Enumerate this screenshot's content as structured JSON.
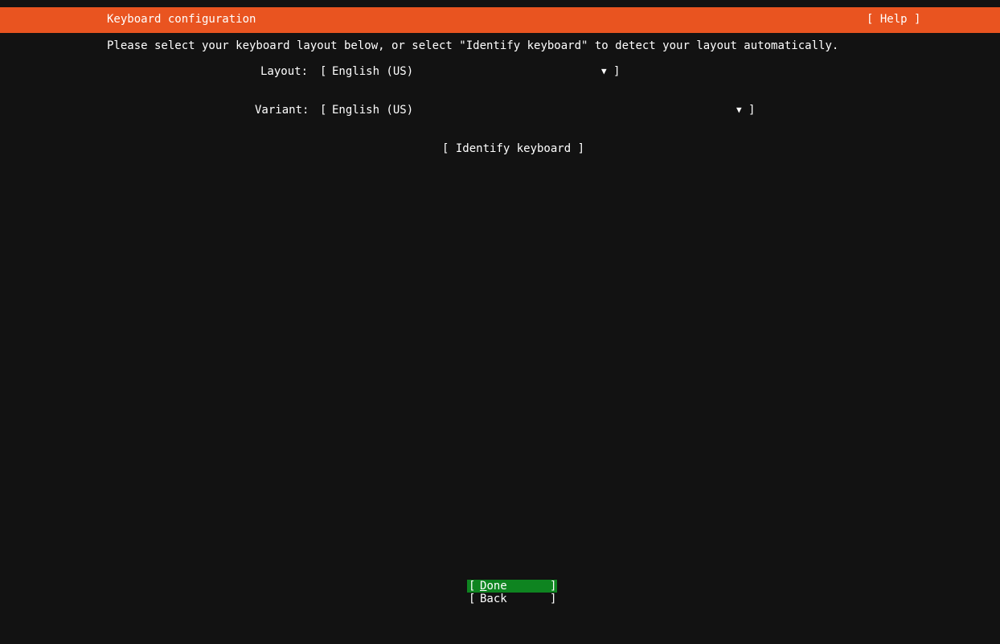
{
  "header": {
    "title": "Keyboard configuration",
    "help_label": "[ Help ]",
    "accent_color": "#e95420"
  },
  "main": {
    "intro": "Please select your keyboard layout below, or select \"Identify keyboard\" to detect your layout automatically.",
    "layout": {
      "label": "Layout:",
      "value": "English (US)"
    },
    "variant": {
      "label": "Variant:",
      "value": "English (US)"
    },
    "identify_label": "[ Identify keyboard ]"
  },
  "footer": {
    "done_label": "Done",
    "back_label": "Back",
    "done_color": "#0e8420"
  },
  "icons": {
    "dropdown_arrow": "▼",
    "open_bracket": "[",
    "close_bracket": "]"
  }
}
